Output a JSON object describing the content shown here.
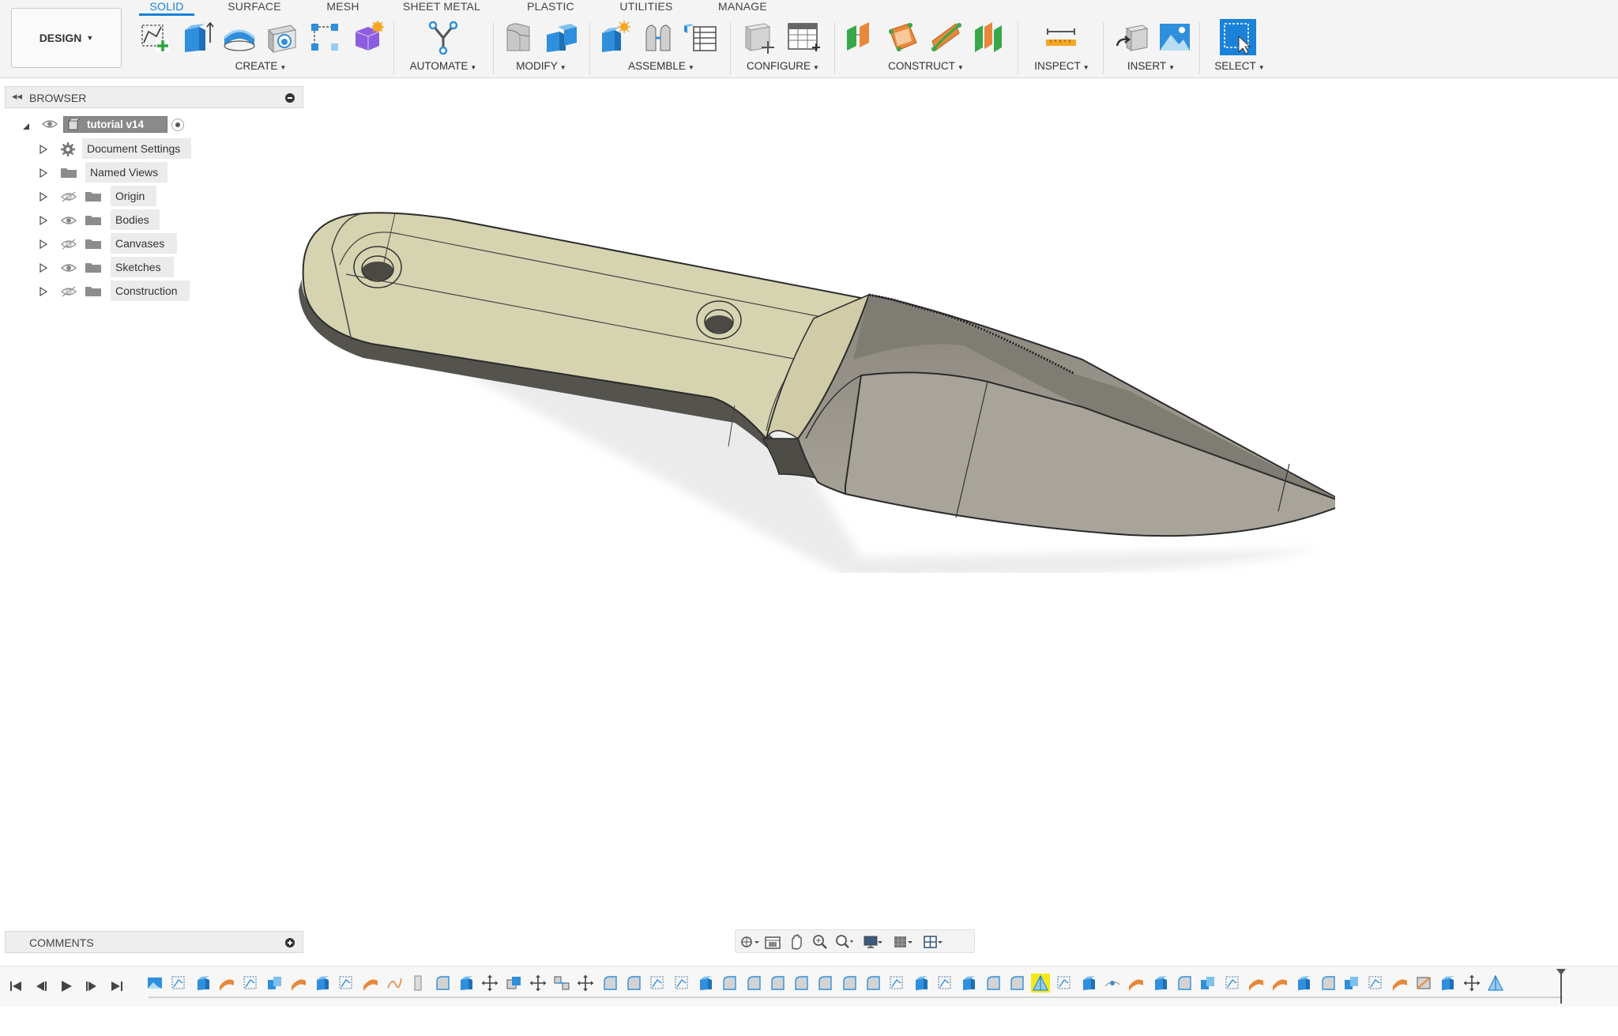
{
  "toolbar": {
    "workspace_button": "DESIGN",
    "tabs": [
      {
        "label": "SOLID",
        "active": true
      },
      {
        "label": "SURFACE",
        "active": false
      },
      {
        "label": "MESH",
        "active": false
      },
      {
        "label": "SHEET METAL",
        "active": false
      },
      {
        "label": "PLASTIC",
        "active": false
      },
      {
        "label": "UTILITIES",
        "active": false
      },
      {
        "label": "MANAGE",
        "active": false
      }
    ],
    "groups": [
      {
        "label": "CREATE",
        "icons": [
          "create-sketch-icon",
          "extrude-icon",
          "revolve-icon",
          "hole-icon",
          "pattern-icon",
          "create-form-icon"
        ]
      },
      {
        "label": "AUTOMATE",
        "icons": [
          "automate-icon"
        ]
      },
      {
        "label": "MODIFY",
        "icons": [
          "press-pull-icon",
          "combine-icon"
        ]
      },
      {
        "label": "ASSEMBLE",
        "icons": [
          "new-component-icon",
          "joint-icon",
          "bom-table-icon"
        ]
      },
      {
        "label": "CONFIGURE",
        "icons": [
          "parameters-icon",
          "configuration-table-icon"
        ]
      },
      {
        "label": "CONSTRUCT",
        "icons": [
          "offset-plane-icon",
          "plane-at-angle-icon",
          "tangent-plane-icon",
          "midplane-icon"
        ]
      },
      {
        "label": "INSPECT",
        "icons": [
          "measure-icon"
        ]
      },
      {
        "label": "INSERT",
        "icons": [
          "insert-mesh-icon",
          "insert-canvas-icon"
        ]
      },
      {
        "label": "SELECT",
        "icons": [
          "select-icon"
        ]
      }
    ]
  },
  "browser": {
    "title": "BROWSER",
    "root": {
      "label": "tutorial v14"
    },
    "nodes": [
      {
        "label": "Document Settings",
        "icon": "gear-icon"
      },
      {
        "label": "Named Views",
        "icon": "folder-icon"
      },
      {
        "label": "Origin",
        "icon": "folder-icon",
        "visibility": "hidden"
      },
      {
        "label": "Bodies",
        "icon": "folder-icon",
        "visibility": "visible"
      },
      {
        "label": "Canvases",
        "icon": "folder-icon",
        "visibility": "hidden"
      },
      {
        "label": "Sketches",
        "icon": "folder-icon",
        "visibility": "visible"
      },
      {
        "label": "Construction",
        "icon": "folder-icon",
        "visibility": "hidden"
      }
    ]
  },
  "comments": {
    "title": "COMMENTS"
  },
  "navbar": {
    "icons": [
      "orbit-icon",
      "look-at-icon",
      "pan-icon",
      "zoom-icon",
      "fit-icon",
      "display-settings-icon",
      "grid-settings-icon",
      "viewports-icon"
    ]
  },
  "timeline": {
    "controls": [
      "skip-to-start-icon",
      "step-back-icon",
      "play-icon",
      "step-forward-icon",
      "skip-to-end-icon"
    ],
    "features": [
      "canvas",
      "sketch",
      "extrude",
      "surface",
      "sketch",
      "combine",
      "surface",
      "extrude",
      "sketch",
      "surface",
      "spline",
      "plane",
      "fillet",
      "extrude",
      "move",
      "copy",
      "move",
      "align",
      "move",
      "fillet",
      "fillet",
      "sketch",
      "sketch",
      "extrude",
      "fillet",
      "fillet",
      "fillet",
      "fillet",
      "fillet",
      "fillet",
      "fillet",
      "sketch",
      "extrude",
      "sketch",
      "extrude",
      "fillet",
      "fillet",
      "draft",
      "sketch",
      "extrude",
      "point",
      "surface",
      "extrude",
      "fillet",
      "combine",
      "sketch",
      "surface",
      "surface",
      "extrude",
      "fillet",
      "combine",
      "sketch",
      "surface",
      "split",
      "extrude",
      "move",
      "draft"
    ],
    "highlighted_index": 37
  },
  "colors": {
    "accent": "#1a82d8",
    "handle": "#d6d3b0",
    "blade": "#a8a49a",
    "blade_dark": "#7f7c74",
    "highlight": "#f4e81a"
  }
}
